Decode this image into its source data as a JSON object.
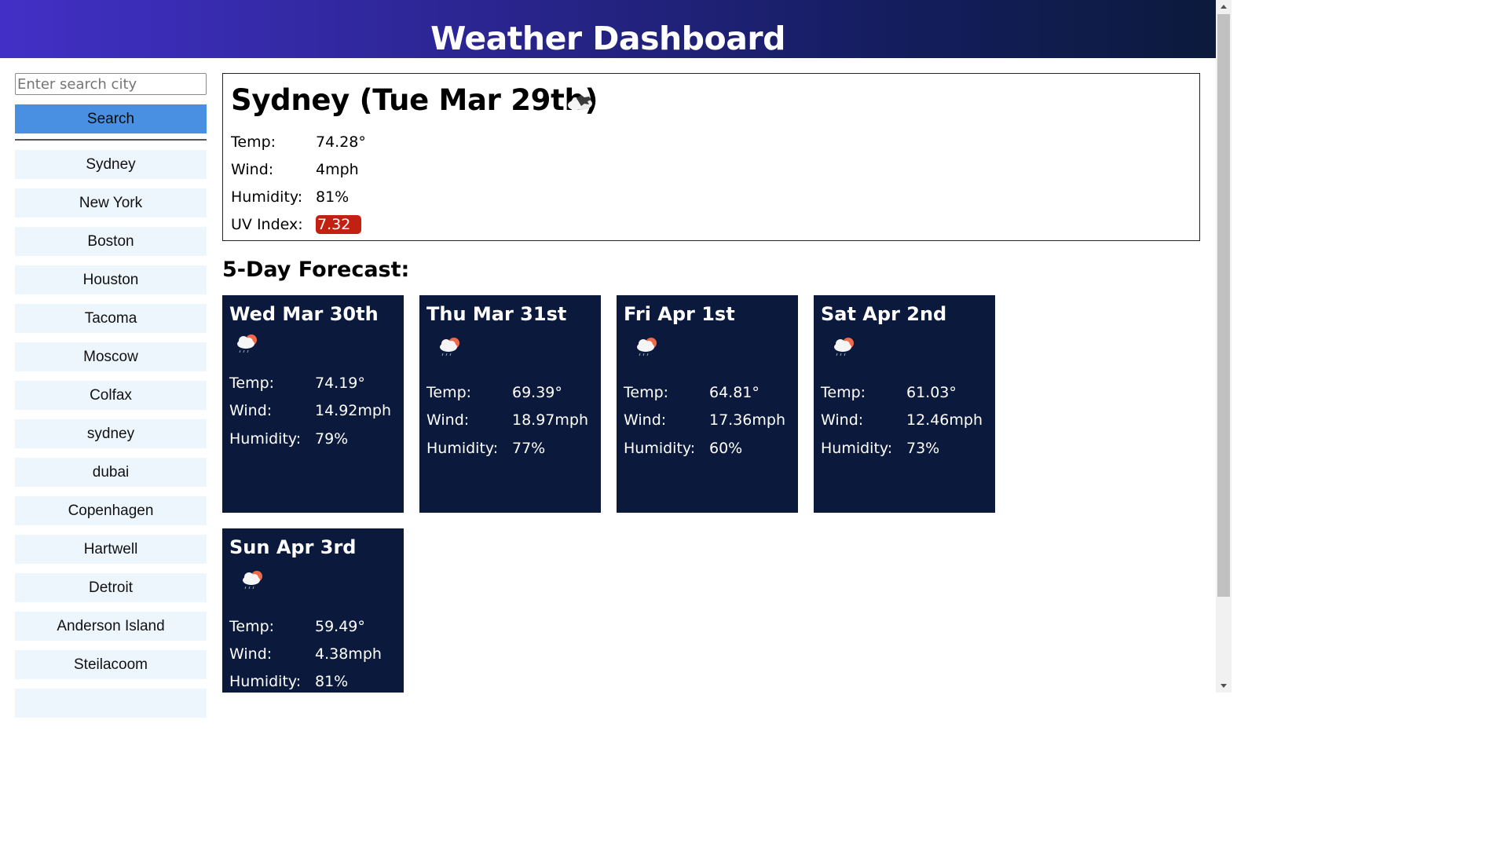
{
  "header": {
    "title": "Weather Dashboard"
  },
  "search": {
    "placeholder": "Enter search city",
    "value": "",
    "button_label": "Search"
  },
  "history": [
    "Sydney",
    "New York",
    "Boston",
    "Houston",
    "Tacoma",
    "Moscow",
    "Colfax",
    "sydney",
    "dubai",
    "Copenhagen",
    "Hartwell",
    "Detroit",
    "Anderson Island",
    "Steilacoom"
  ],
  "current": {
    "title": "Sydney (Tue Mar 29th)",
    "icon": "cloud-icon",
    "temp_label": "Temp:",
    "temp": "74.28°",
    "wind_label": "Wind:",
    "wind": "4mph",
    "humidity_label": "Humidity:",
    "humidity": "81%",
    "uv_label": "UV Index:",
    "uv": "7.32",
    "uv_color": "#c22010"
  },
  "forecast": {
    "title": "5-Day Forecast:",
    "labels": {
      "temp": "Temp:",
      "wind": "Wind:",
      "humidity": "Humidity:"
    },
    "days": [
      {
        "date": "Wed Mar 30th",
        "icon": "rain-cloud-sun-icon",
        "temp": "74.19°",
        "wind": "14.92mph",
        "humidity": "79%"
      },
      {
        "date": "Thu Mar 31st",
        "icon": "rain-cloud-sun-icon",
        "temp": "69.39°",
        "wind": "18.97mph",
        "humidity": "77%"
      },
      {
        "date": "Fri Apr 1st",
        "icon": "rain-cloud-sun-icon",
        "temp": "64.81°",
        "wind": "17.36mph",
        "humidity": "60%"
      },
      {
        "date": "Sat Apr 2nd",
        "icon": "rain-cloud-sun-icon",
        "temp": "61.03°",
        "wind": "12.46mph",
        "humidity": "73%"
      },
      {
        "date": "Sun Apr 3rd",
        "icon": "rain-cloud-sun-icon",
        "temp": "59.49°",
        "wind": "4.38mph",
        "humidity": "81%"
      }
    ],
    "card_color": "#0b1a3c"
  },
  "colors": {
    "accent": "#4a90e2",
    "history_bg": "#eef6fd"
  }
}
